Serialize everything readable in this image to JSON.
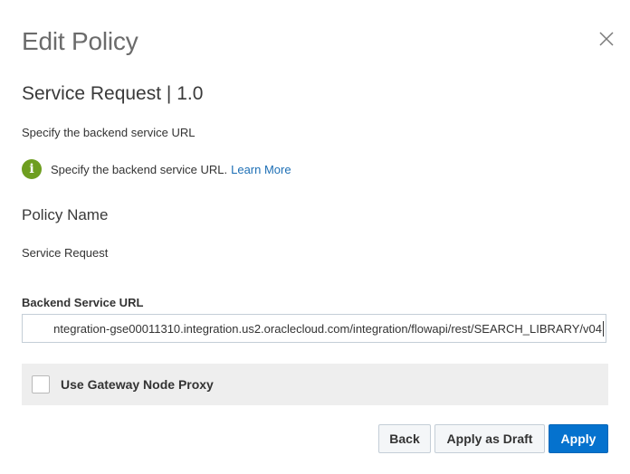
{
  "dialog": {
    "title": "Edit Policy",
    "close_icon": "close-icon",
    "subtitle": "Service Request | 1.0",
    "description": "Specify the backend service URL",
    "info": {
      "icon": "info-icon",
      "icon_glyph": "i",
      "text": "Specify the backend service URL.",
      "link": "Learn More"
    }
  },
  "policy_name": {
    "heading": "Policy Name",
    "value": "Service Request"
  },
  "backend_url": {
    "label": "Backend Service URL",
    "value": "ntegration-gse00011310.integration.us2.oraclecloud.com/integration/flowapi/rest/SEARCH_LIBRARY/v04"
  },
  "gateway_proxy": {
    "label": "Use Gateway Node Proxy",
    "checked": "false"
  },
  "footer": {
    "back_label": "Back",
    "draft_label": "Apply as Draft",
    "apply_label": "Apply"
  },
  "colors": {
    "primary": "#0572ce",
    "info_green": "#6e9e1f",
    "link": "#1d6fb5"
  }
}
